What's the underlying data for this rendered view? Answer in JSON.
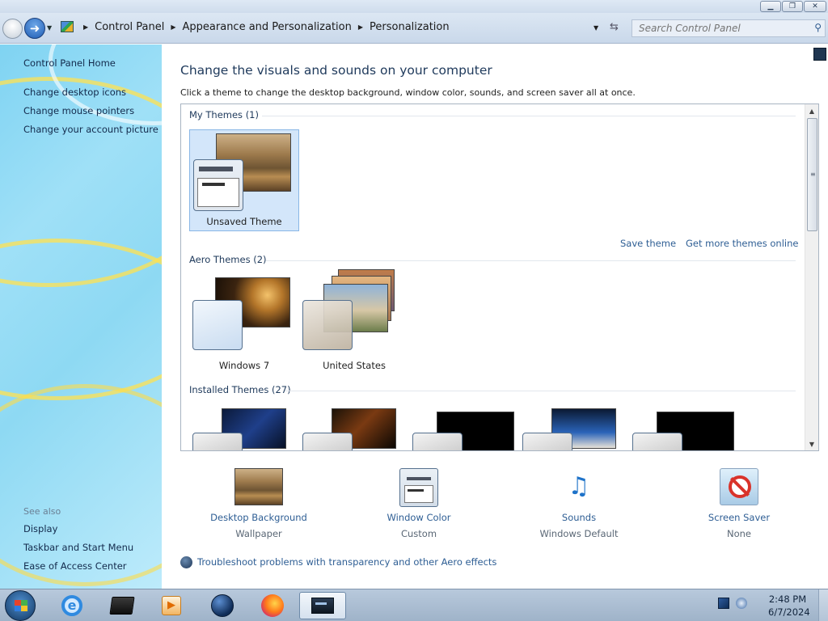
{
  "window": {
    "minimize_glyph": "▁",
    "maximize_glyph": "❐",
    "close_glyph": "✕"
  },
  "navigation": {
    "back_glyph": "",
    "forward_glyph": "➜",
    "breadcrumbs": [
      "Control Panel",
      "Appearance and Personalization",
      "Personalization"
    ],
    "search_placeholder": "Search Control Panel"
  },
  "sidebar": {
    "home": "Control Panel Home",
    "links": [
      "Change desktop icons",
      "Change mouse pointers",
      "Change your account picture"
    ],
    "see_also_title": "See also",
    "see_also": [
      "Display",
      "Taskbar and Start Menu",
      "Ease of Access Center"
    ]
  },
  "main": {
    "title": "Change the visuals and sounds on your computer",
    "subtitle": "Click a theme to change the desktop background, window color, sounds, and screen saver all at once.",
    "groups": {
      "my_themes": "My Themes (1)",
      "aero_themes": "Aero Themes (2)",
      "installed_themes": "Installed Themes (27)"
    },
    "my_themes": [
      {
        "name": "Unsaved Theme",
        "selected": true
      }
    ],
    "aero_themes": [
      {
        "name": "Windows 7"
      },
      {
        "name": "United States"
      }
    ],
    "save_theme": "Save theme",
    "get_more": "Get more themes online",
    "settings": [
      {
        "label": "Desktop Background",
        "value": "Wallpaper",
        "icon": "wallpaper-icon"
      },
      {
        "label": "Window Color",
        "value": "Custom",
        "icon": "window-color-icon"
      },
      {
        "label": "Sounds",
        "value": "Windows Default",
        "icon": "sounds-icon"
      },
      {
        "label": "Screen Saver",
        "value": "None",
        "icon": "screen-saver-icon"
      }
    ],
    "troubleshoot": "Troubleshoot problems with transparency and other Aero effects"
  },
  "taskbar": {
    "time": "2:48 PM",
    "date": "6/7/2024",
    "items": [
      "internet-explorer-icon",
      "terminal-icon",
      "media-player-icon",
      "globe-icon",
      "firefox-icon",
      "personalization-window-icon"
    ]
  },
  "colors": {
    "link": "#2e5e94",
    "title": "#1e395b",
    "selection": "#d3e6fa"
  }
}
